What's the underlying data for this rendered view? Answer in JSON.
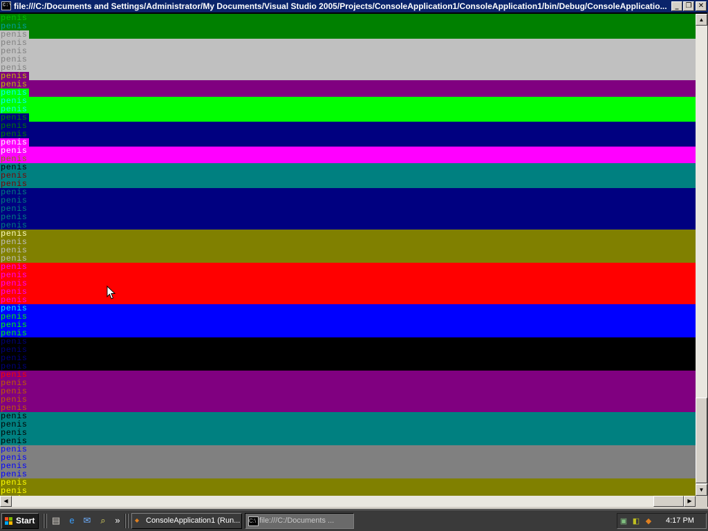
{
  "window": {
    "title": "file:///C:/Documents and Settings/Administrator/My Documents/Visual Studio 2005/Projects/ConsoleApplication1/ConsoleApplication1/bin/Debug/ConsoleApplicatio...",
    "minimize_glyph": "_",
    "maximize_glyph": "❐",
    "close_glyph": "✕",
    "icon_text": "C:\\"
  },
  "console": {
    "word": "penis",
    "lines": [
      {
        "fg": "#00c000",
        "bg": "#008000"
      },
      {
        "fg": "#00a0a0",
        "bg": "#008000"
      },
      {
        "fg": "#808080",
        "bg": "#c0c0c0"
      },
      {
        "fg": "#808080",
        "bg": "#c0c0c0"
      },
      {
        "fg": "#808080",
        "bg": "#c0c0c0"
      },
      {
        "fg": "#808080",
        "bg": "#c0c0c0"
      },
      {
        "fg": "#808080",
        "bg": "#c0c0c0"
      },
      {
        "fg": "#c0c000",
        "bg": "#800080"
      },
      {
        "fg": "#c0c000",
        "bg": "#800080"
      },
      {
        "fg": "#00ffff",
        "bg": "#00ff00"
      },
      {
        "fg": "#00ffff",
        "bg": "#00ff00"
      },
      {
        "fg": "#00ffff",
        "bg": "#00ff00"
      },
      {
        "fg": "#008000",
        "bg": "#000080"
      },
      {
        "fg": "#008000",
        "bg": "#000080"
      },
      {
        "fg": "#008000",
        "bg": "#000080"
      },
      {
        "fg": "#ffffff",
        "bg": "#ff00ff"
      },
      {
        "fg": "#ffffff",
        "bg": "#ff00ff"
      },
      {
        "fg": "#808000",
        "bg": "#ff00ff"
      },
      {
        "fg": "#000000",
        "bg": "#008080"
      },
      {
        "fg": "#800000",
        "bg": "#008080"
      },
      {
        "fg": "#800000",
        "bg": "#008080"
      },
      {
        "fg": "#008080",
        "bg": "#000080"
      },
      {
        "fg": "#008080",
        "bg": "#000080"
      },
      {
        "fg": "#008080",
        "bg": "#000080"
      },
      {
        "fg": "#008080",
        "bg": "#000080"
      },
      {
        "fg": "#008080",
        "bg": "#000080"
      },
      {
        "fg": "#ffffc0",
        "bg": "#808000"
      },
      {
        "fg": "#c0c0c0",
        "bg": "#808000"
      },
      {
        "fg": "#c0c0c0",
        "bg": "#808000"
      },
      {
        "fg": "#c0c0c0",
        "bg": "#808000"
      },
      {
        "fg": "#ff00ff",
        "bg": "#ff0000"
      },
      {
        "fg": "#ff00ff",
        "bg": "#ff0000"
      },
      {
        "fg": "#ff00ff",
        "bg": "#ff0000"
      },
      {
        "fg": "#ff00ff",
        "bg": "#ff0000"
      },
      {
        "fg": "#ff00ff",
        "bg": "#ff0000"
      },
      {
        "fg": "#00ffff",
        "bg": "#0000ff"
      },
      {
        "fg": "#00ff00",
        "bg": "#0000ff"
      },
      {
        "fg": "#00ff00",
        "bg": "#0000ff"
      },
      {
        "fg": "#00ff00",
        "bg": "#0000ff"
      },
      {
        "fg": "#000080",
        "bg": "#000000"
      },
      {
        "fg": "#000080",
        "bg": "#000000"
      },
      {
        "fg": "#000080",
        "bg": "#000000"
      },
      {
        "fg": "#000080",
        "bg": "#000000"
      },
      {
        "fg": "#ff0000",
        "bg": "#800080"
      },
      {
        "fg": "#c06000",
        "bg": "#800080"
      },
      {
        "fg": "#c06000",
        "bg": "#800080"
      },
      {
        "fg": "#c06000",
        "bg": "#800080"
      },
      {
        "fg": "#c06000",
        "bg": "#800080"
      },
      {
        "fg": "#000000",
        "bg": "#008080"
      },
      {
        "fg": "#000000",
        "bg": "#008080"
      },
      {
        "fg": "#000000",
        "bg": "#008080"
      },
      {
        "fg": "#000000",
        "bg": "#008080"
      },
      {
        "fg": "#0000ff",
        "bg": "#808080"
      },
      {
        "fg": "#0000ff",
        "bg": "#808080"
      },
      {
        "fg": "#0000ff",
        "bg": "#808080"
      },
      {
        "fg": "#0000ff",
        "bg": "#808080"
      },
      {
        "fg": "#ffff00",
        "bg": "#808000"
      },
      {
        "fg": "#ffff00",
        "bg": "#808000"
      },
      {
        "fg": "#ffff00",
        "bg": "#808000"
      }
    ],
    "bands": [
      {
        "bg": "#008000",
        "rows": 3
      },
      {
        "bg": "#c0c0c0",
        "rows": 5
      },
      {
        "bg": "#800080",
        "rows": 2
      },
      {
        "bg": "#00ff00",
        "rows": 3
      },
      {
        "bg": "#000080",
        "rows": 3
      },
      {
        "bg": "#ff00ff",
        "rows": 2
      },
      {
        "bg": "#008080",
        "rows": 3
      },
      {
        "bg": "#000080",
        "rows": 5
      },
      {
        "bg": "#808000",
        "rows": 4
      },
      {
        "bg": "#ff0000",
        "rows": 5
      },
      {
        "bg": "#0000ff",
        "rows": 4
      },
      {
        "bg": "#000000",
        "rows": 4
      },
      {
        "bg": "#800080",
        "rows": 5
      },
      {
        "bg": "#008080",
        "rows": 4
      },
      {
        "bg": "#808080",
        "rows": 4
      },
      {
        "bg": "#808000",
        "rows": 3
      }
    ]
  },
  "scrollbars": {
    "up_glyph": "▲",
    "down_glyph": "▼",
    "left_glyph": "◀",
    "right_glyph": "▶"
  },
  "taskbar": {
    "start_label": "Start",
    "overflow_glyph": "»",
    "tasks": [
      {
        "label": "ConsoleApplication1 (Run...",
        "active": false
      },
      {
        "label": "file:///C:/Documents ...",
        "active": true
      }
    ],
    "clock": "4:17 PM"
  }
}
